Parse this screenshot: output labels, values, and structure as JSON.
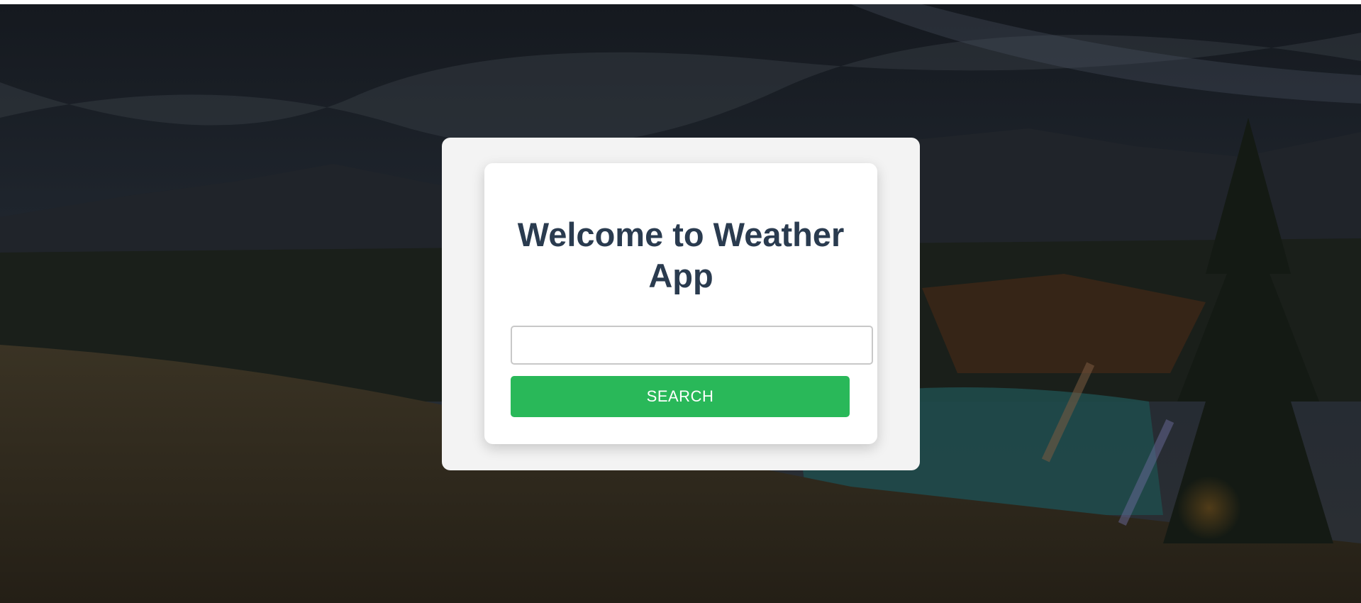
{
  "app": {
    "title": "Welcome to Weather App"
  },
  "search": {
    "value": "",
    "placeholder": "",
    "button_label": "SEARCH"
  },
  "colors": {
    "button_bg": "#29b859",
    "title_text": "#2a3b4f",
    "card_bg": "#ffffff",
    "panel_bg": "#f3f3f3"
  }
}
